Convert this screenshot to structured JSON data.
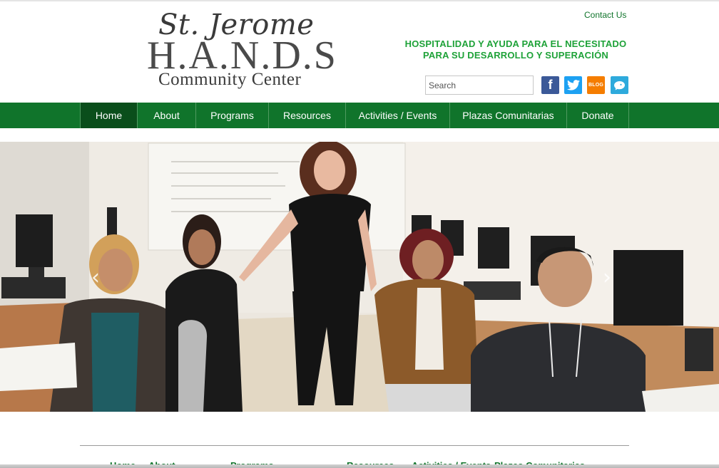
{
  "header": {
    "logo": {
      "line1": "St. Jerome",
      "line2": "H.A.N.D.S",
      "line3": "Community Center"
    },
    "contact_link": "Contact Us",
    "tagline_line1": "HOSPITALIDAD Y AYUDA PARA EL NECESITADO",
    "tagline_line2": "PARA SU DESARROLLO Y SUPERACIÓN",
    "search": {
      "placeholder": "Search",
      "value": ""
    },
    "social": {
      "facebook": "f",
      "blog": "BLOG"
    }
  },
  "nav": {
    "items": [
      {
        "label": "Home",
        "active": true
      },
      {
        "label": "About"
      },
      {
        "label": "Programs"
      },
      {
        "label": "Resources"
      },
      {
        "label": "Activities / Events"
      },
      {
        "label": "Plazas Comunitarias"
      },
      {
        "label": "Donate"
      }
    ]
  },
  "slider": {
    "prev_arrow": "‹",
    "next_arrow": "›",
    "slide": "Photo of five people in a computer lab classroom"
  },
  "footer": {
    "links": [
      "Home",
      "About",
      "Programs",
      "Resources",
      "Activities / Events",
      "Plazas Comunitarias"
    ]
  },
  "colors": {
    "brand_green": "#10742b",
    "tagline_green": "#1ea238",
    "nav_active": "#0a4e1b",
    "facebook": "#3b5998",
    "twitter": "#1da1f2",
    "blog": "#f57d00",
    "chat": "#2eaadc"
  }
}
